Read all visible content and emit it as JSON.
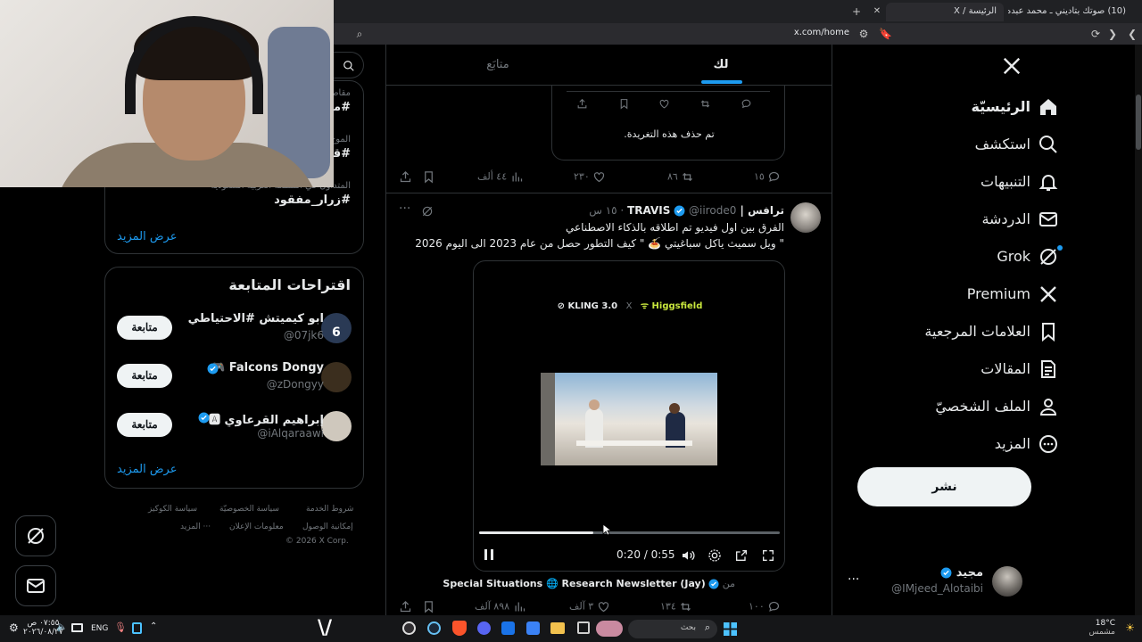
{
  "browser": {
    "tabs": [
      {
        "title": "(10) صوتك بتاديني ـ محمد عبده ـ",
        "active": false
      },
      {
        "title": "الرئيسة / X",
        "active": true
      }
    ],
    "url": "x.com/home"
  },
  "sidebar": {
    "logo": "x-logo-icon",
    "items": [
      {
        "label": "الرئيسيّة",
        "icon": "home-icon",
        "bold": true
      },
      {
        "label": "استكشف",
        "icon": "search-icon"
      },
      {
        "label": "التنبيهات",
        "icon": "bell-icon"
      },
      {
        "label": "الدردشة",
        "icon": "mail-icon"
      },
      {
        "label": "Grok",
        "icon": "grok-icon"
      },
      {
        "label": "Premium",
        "icon": "x-premium-icon"
      },
      {
        "label": "العلامات المرجعية",
        "icon": "bookmark-icon"
      },
      {
        "label": "المقالات",
        "icon": "article-icon"
      },
      {
        "label": "الملف الشخصيّ",
        "icon": "profile-icon"
      },
      {
        "label": "المزيد",
        "icon": "more-circle-icon"
      }
    ],
    "post_button": "نشر",
    "account": {
      "name": "مجيد",
      "handle": "@IMjeed_Alotaibi"
    }
  },
  "timeline": {
    "tabs": [
      {
        "label": "لك",
        "active": true
      },
      {
        "label": "متابَع",
        "active": false
      }
    ],
    "deleted_notice": "تم حذف هذه التغريدة.",
    "prev_post_actions": {
      "replies": "١٥",
      "reposts": "٨٦",
      "likes": "٢٣٠",
      "views": "٤٤ ألف"
    },
    "post": {
      "name": "ترافس | TRAVIS",
      "handle": "@iirode0",
      "time": "١٥ س",
      "line1": "الفرق بين اول فيديو تم اطلاقه بالذكاء الاصطناعي",
      "line2": "\" ويل سميث ياكل سباغيتي 🍝 \" كيف التطور حصل من عام 2023 الى اليوم 2026",
      "video_brand_left": "KLING 3.0",
      "video_brand_x": "X",
      "video_brand_right": "Higgsfield",
      "time_display": "0:20 / 0:55",
      "progress": 0.38,
      "source_prefix": "من",
      "source_name": "Special Situations 🌐 Research Newsletter (Jay)",
      "actions": {
        "replies": "١٠٠",
        "reposts": "١٣٤",
        "likes": "٣ آلف",
        "views": "٨٩٨ آلف"
      }
    }
  },
  "right_panel": {
    "trends": [
      {
        "meta": "مقاط",
        "tag": "#ما"
      },
      {
        "meta": "الموج",
        "tag": "#قو"
      },
      {
        "meta": "المتداول في المملكة العربية السعودية",
        "tag": "#زرار_مفقود"
      }
    ],
    "show_more": "عرض المزيد",
    "suggestions_title": "اقتراحات المتابعة",
    "suggestions": [
      {
        "name": "ابو كيميتش #الاحتياطي",
        "handle": "@07jk6",
        "verified": false
      },
      {
        "name": "Falcons Dongy 🎮",
        "handle": "@zDongyy",
        "verified": true
      },
      {
        "name": "إبراهيم القرعاوي 🅰",
        "handle": "@iAlqaraawi",
        "verified": true
      }
    ],
    "follow_label": "متابعة",
    "footer": {
      "row1": [
        "شروط الخدمة",
        "سياسة الخصوصيّة",
        "سياسة الكوكيز"
      ],
      "row2": [
        "إمكانية الوصول",
        "معلومات الإعلان",
        "··· المزيد"
      ],
      "copyright": "© 2026 X Corp."
    }
  },
  "taskbar": {
    "weather_temp": "18°C",
    "weather_desc": "مشمس",
    "search_placeholder": "بحث",
    "lang": "ENG",
    "time": "٠٧:٥٥ ص",
    "date": "٢٠٢٦/٠٨/٢٧"
  },
  "colors": {
    "accent": "#1d9bf0",
    "background": "#000000",
    "border": "#2f3336",
    "muted": "#71767b"
  }
}
